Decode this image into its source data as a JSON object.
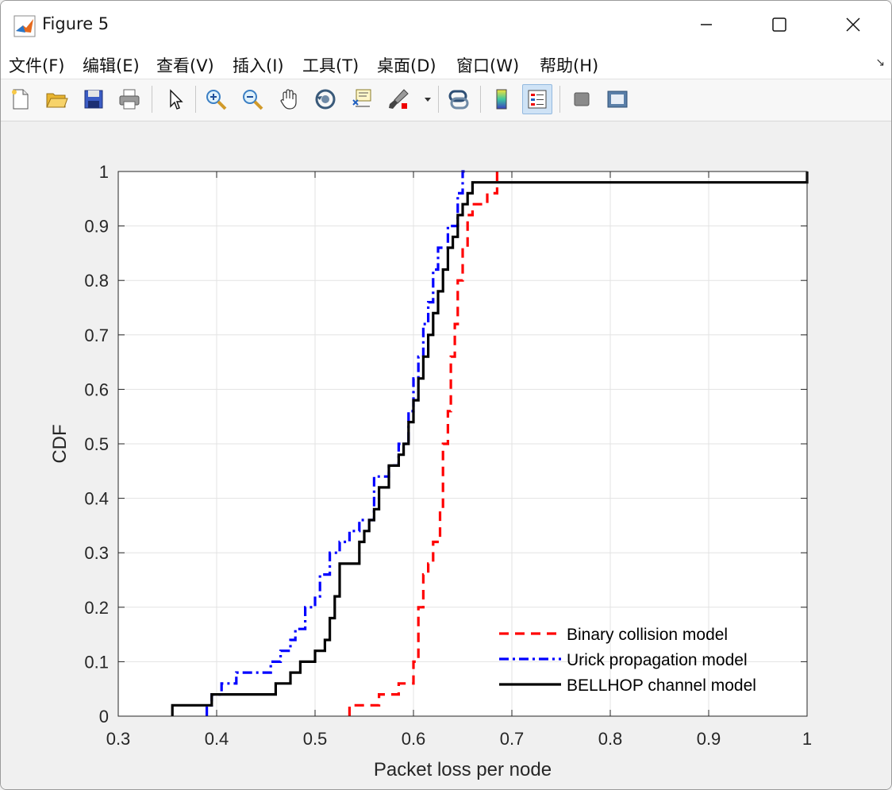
{
  "window": {
    "title": "Figure 5"
  },
  "menu": [
    "文件(F)",
    "编辑(E)",
    "查看(V)",
    "插入(I)",
    "工具(T)",
    "桌面(D)",
    "窗口(W)",
    "帮助(H)"
  ],
  "toolbar": {
    "tools": [
      "new-figure-icon",
      "open-file-icon",
      "save-icon",
      "print-icon",
      "pointer-icon",
      "zoom-in-icon",
      "zoom-out-icon",
      "pan-hand-icon",
      "rotate-3d-icon",
      "data-cursor-icon",
      "brush-icon",
      "link-plot-icon",
      "colorbar-icon",
      "legend-icon",
      "hide-plot-tools-icon",
      "show-plot-tools-icon"
    ]
  },
  "chart_data": {
    "type": "line",
    "xlabel": "Packet loss per node",
    "ylabel": "CDF",
    "xlim": [
      0.3,
      1
    ],
    "ylim": [
      0,
      1
    ],
    "xticks": [
      "0.3",
      "0.4",
      "0.5",
      "0.6",
      "0.7",
      "0.8",
      "0.9",
      "1"
    ],
    "yticks": [
      "0",
      "0.1",
      "0.2",
      "0.3",
      "0.4",
      "0.5",
      "0.6",
      "0.7",
      "0.8",
      "0.9",
      "1"
    ],
    "grid": true,
    "legend_position": "bottom-right",
    "series": [
      {
        "name": "Binary collision model",
        "color": "#ff0000",
        "style": "dashed",
        "points": [
          [
            0.535,
            0
          ],
          [
            0.535,
            0.02
          ],
          [
            0.565,
            0.02
          ],
          [
            0.565,
            0.04
          ],
          [
            0.585,
            0.04
          ],
          [
            0.585,
            0.06
          ],
          [
            0.6,
            0.06
          ],
          [
            0.6,
            0.1
          ],
          [
            0.605,
            0.1
          ],
          [
            0.605,
            0.2
          ],
          [
            0.61,
            0.2
          ],
          [
            0.61,
            0.26
          ],
          [
            0.615,
            0.26
          ],
          [
            0.615,
            0.28
          ],
          [
            0.62,
            0.28
          ],
          [
            0.62,
            0.32
          ],
          [
            0.627,
            0.32
          ],
          [
            0.627,
            0.38
          ],
          [
            0.63,
            0.38
          ],
          [
            0.63,
            0.5
          ],
          [
            0.635,
            0.5
          ],
          [
            0.635,
            0.56
          ],
          [
            0.638,
            0.56
          ],
          [
            0.638,
            0.66
          ],
          [
            0.642,
            0.66
          ],
          [
            0.642,
            0.72
          ],
          [
            0.645,
            0.72
          ],
          [
            0.645,
            0.8
          ],
          [
            0.65,
            0.8
          ],
          [
            0.65,
            0.86
          ],
          [
            0.655,
            0.86
          ],
          [
            0.655,
            0.92
          ],
          [
            0.66,
            0.92
          ],
          [
            0.66,
            0.94
          ],
          [
            0.675,
            0.94
          ],
          [
            0.675,
            0.96
          ],
          [
            0.685,
            0.96
          ],
          [
            0.685,
            1
          ],
          [
            0.69,
            1
          ]
        ]
      },
      {
        "name": "Urick propagation model",
        "color": "#0000ff",
        "style": "dashdot",
        "points": [
          [
            0.39,
            0
          ],
          [
            0.39,
            0.02
          ],
          [
            0.395,
            0.02
          ],
          [
            0.395,
            0.04
          ],
          [
            0.405,
            0.04
          ],
          [
            0.405,
            0.06
          ],
          [
            0.42,
            0.06
          ],
          [
            0.42,
            0.08
          ],
          [
            0.455,
            0.08
          ],
          [
            0.455,
            0.1
          ],
          [
            0.465,
            0.1
          ],
          [
            0.465,
            0.12
          ],
          [
            0.475,
            0.12
          ],
          [
            0.475,
            0.14
          ],
          [
            0.48,
            0.14
          ],
          [
            0.48,
            0.16
          ],
          [
            0.49,
            0.16
          ],
          [
            0.49,
            0.2
          ],
          [
            0.5,
            0.2
          ],
          [
            0.5,
            0.22
          ],
          [
            0.505,
            0.22
          ],
          [
            0.505,
            0.26
          ],
          [
            0.515,
            0.26
          ],
          [
            0.515,
            0.3
          ],
          [
            0.525,
            0.3
          ],
          [
            0.525,
            0.32
          ],
          [
            0.535,
            0.32
          ],
          [
            0.535,
            0.34
          ],
          [
            0.545,
            0.34
          ],
          [
            0.545,
            0.36
          ],
          [
            0.56,
            0.36
          ],
          [
            0.56,
            0.44
          ],
          [
            0.575,
            0.44
          ],
          [
            0.575,
            0.46
          ],
          [
            0.585,
            0.46
          ],
          [
            0.585,
            0.5
          ],
          [
            0.595,
            0.5
          ],
          [
            0.595,
            0.56
          ],
          [
            0.6,
            0.56
          ],
          [
            0.6,
            0.62
          ],
          [
            0.605,
            0.62
          ],
          [
            0.605,
            0.66
          ],
          [
            0.61,
            0.66
          ],
          [
            0.61,
            0.72
          ],
          [
            0.615,
            0.72
          ],
          [
            0.615,
            0.76
          ],
          [
            0.62,
            0.76
          ],
          [
            0.62,
            0.82
          ],
          [
            0.625,
            0.82
          ],
          [
            0.625,
            0.86
          ],
          [
            0.635,
            0.86
          ],
          [
            0.635,
            0.9
          ],
          [
            0.645,
            0.9
          ],
          [
            0.645,
            0.96
          ],
          [
            0.65,
            0.96
          ],
          [
            0.65,
            1
          ],
          [
            0.652,
            1
          ]
        ]
      },
      {
        "name": "BELLHOP channel model",
        "color": "#000000",
        "style": "solid",
        "points": [
          [
            0.355,
            0
          ],
          [
            0.355,
            0.02
          ],
          [
            0.395,
            0.02
          ],
          [
            0.395,
            0.04
          ],
          [
            0.46,
            0.04
          ],
          [
            0.46,
            0.06
          ],
          [
            0.475,
            0.06
          ],
          [
            0.475,
            0.08
          ],
          [
            0.485,
            0.08
          ],
          [
            0.485,
            0.1
          ],
          [
            0.5,
            0.1
          ],
          [
            0.5,
            0.12
          ],
          [
            0.51,
            0.12
          ],
          [
            0.51,
            0.14
          ],
          [
            0.515,
            0.14
          ],
          [
            0.515,
            0.18
          ],
          [
            0.52,
            0.18
          ],
          [
            0.52,
            0.22
          ],
          [
            0.525,
            0.22
          ],
          [
            0.525,
            0.28
          ],
          [
            0.545,
            0.28
          ],
          [
            0.545,
            0.32
          ],
          [
            0.55,
            0.32
          ],
          [
            0.55,
            0.34
          ],
          [
            0.555,
            0.34
          ],
          [
            0.555,
            0.36
          ],
          [
            0.56,
            0.36
          ],
          [
            0.56,
            0.38
          ],
          [
            0.565,
            0.38
          ],
          [
            0.565,
            0.42
          ],
          [
            0.575,
            0.42
          ],
          [
            0.575,
            0.46
          ],
          [
            0.585,
            0.46
          ],
          [
            0.585,
            0.48
          ],
          [
            0.59,
            0.48
          ],
          [
            0.59,
            0.5
          ],
          [
            0.595,
            0.5
          ],
          [
            0.595,
            0.54
          ],
          [
            0.6,
            0.54
          ],
          [
            0.6,
            0.58
          ],
          [
            0.605,
            0.58
          ],
          [
            0.605,
            0.62
          ],
          [
            0.61,
            0.62
          ],
          [
            0.61,
            0.66
          ],
          [
            0.615,
            0.66
          ],
          [
            0.615,
            0.7
          ],
          [
            0.62,
            0.7
          ],
          [
            0.62,
            0.74
          ],
          [
            0.625,
            0.74
          ],
          [
            0.625,
            0.78
          ],
          [
            0.63,
            0.78
          ],
          [
            0.63,
            0.82
          ],
          [
            0.635,
            0.82
          ],
          [
            0.635,
            0.86
          ],
          [
            0.64,
            0.86
          ],
          [
            0.64,
            0.88
          ],
          [
            0.645,
            0.88
          ],
          [
            0.645,
            0.92
          ],
          [
            0.65,
            0.92
          ],
          [
            0.65,
            0.94
          ],
          [
            0.655,
            0.94
          ],
          [
            0.655,
            0.96
          ],
          [
            0.66,
            0.96
          ],
          [
            0.66,
            0.98
          ],
          [
            1.0,
            0.98
          ],
          [
            1.0,
            1
          ]
        ]
      }
    ]
  }
}
